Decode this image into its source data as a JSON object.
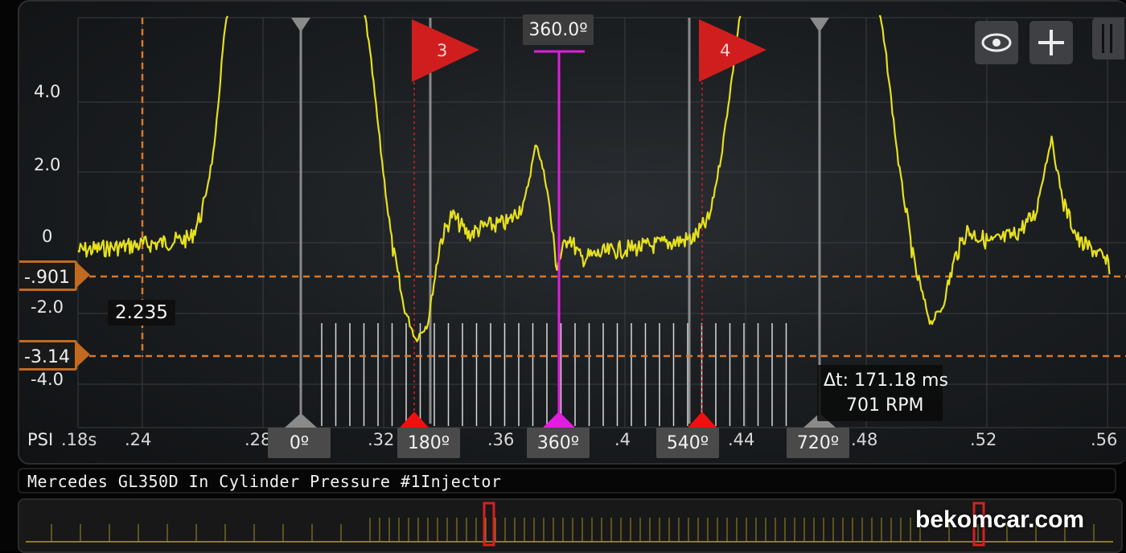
{
  "y_axis": {
    "unit": "PSI",
    "labels": [
      "4.0",
      "2.0",
      "0",
      "-2.0",
      "-4.0"
    ]
  },
  "x_axis": {
    "unit": "s",
    "labels": [
      ".18s",
      ".24",
      ".28",
      ".32",
      ".36",
      ".4",
      ".44",
      ".48",
      ".52",
      ".56"
    ]
  },
  "cursors": {
    "c0": "0º",
    "c180": "180º",
    "c360": "360º",
    "c540": "540º",
    "c720": "720º",
    "top_360": "360.0º"
  },
  "markers": {
    "m3": "3",
    "m4": "4"
  },
  "y_cursors": {
    "upper": "-.901",
    "lower": "-3.14"
  },
  "readouts": {
    "time_cursor": "2.235",
    "delta_t": "Δt: 171.18 ms",
    "rpm": "701 RPM"
  },
  "toolbar": {
    "eye_icon": "eye-icon",
    "add_icon": "plus-icon"
  },
  "channel_title": "Mercedes GL350D In Cylinder Pressure #1Injector",
  "watermark": "bekomcar.com",
  "colors": {
    "trace": "#e6e01e",
    "cursor360": "#e01ee0",
    "ycursor": "#d9782a",
    "marker": "#d62020"
  }
}
